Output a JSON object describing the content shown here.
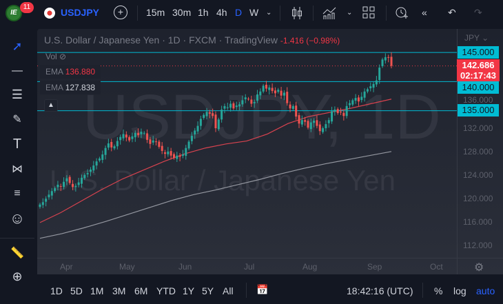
{
  "topbar": {
    "notifications": "11",
    "logo_text": "IE",
    "symbol": "USDJPY",
    "intervals": [
      "15m",
      "30m",
      "1h",
      "4h",
      "D",
      "W"
    ],
    "active_interval": "D"
  },
  "legend": {
    "title": "U.S. Dollar / Japanese Yen · 1D · FXCM · TradingView",
    "change": "-1.416 (−0.98%)",
    "vol_label": "Vol",
    "ema1_label": "EMA",
    "ema1_value": "136.880",
    "ema2_label": "EMA",
    "ema2_value": "127.838"
  },
  "watermark": {
    "line1": "USDJPY, 1D",
    "line2": "U.S. Dollar / Japanese Yen"
  },
  "price_axis": {
    "currency": "JPY",
    "labels": [
      "136.000",
      "132.000",
      "128.000",
      "124.000",
      "120.000",
      "116.000",
      "112.000"
    ],
    "levels": [
      "145.000",
      "140.000",
      "135.000"
    ],
    "current_price": "142.686",
    "countdown": "02:17:43"
  },
  "time_axis": [
    "Apr",
    "May",
    "Jun",
    "Jul",
    "Aug",
    "Sep",
    "Oct"
  ],
  "bottom": {
    "ranges": [
      "1D",
      "5D",
      "1M",
      "3M",
      "6M",
      "YTD",
      "1Y",
      "5Y",
      "All"
    ],
    "clock": "18:42:16 (UTC)",
    "percent": "%",
    "log": "log",
    "auto": "auto"
  },
  "colors": {
    "up": "#26a69a",
    "down": "#ef5350",
    "level": "#00bcd4",
    "price": "#f23645",
    "ema_fast": "#d9434f",
    "ema_slow": "#9598a1",
    "accent": "#2962ff"
  },
  "chart_data": {
    "type": "candlestick",
    "ylim": [
      110,
      149
    ],
    "horizontal_levels": [
      145,
      140,
      135
    ],
    "closes": [
      118.9,
      119.3,
      119.9,
      120.6,
      121.2,
      121.7,
      122.3,
      122.0,
      122.8,
      123.4,
      122.6,
      121.9,
      122.1,
      122.7,
      123.5,
      124.0,
      124.3,
      124.9,
      125.6,
      126.3,
      126.8,
      127.5,
      128.6,
      129.4,
      128.7,
      128.9,
      129.8,
      130.5,
      131.0,
      130.4,
      129.9,
      130.6,
      131.2,
      130.8,
      131.4,
      131.2,
      130.0,
      129.3,
      129.9,
      129.7,
      128.8,
      128.1,
      127.6,
      128.0,
      127.3,
      126.9,
      127.3,
      127.1,
      127.5,
      128.6,
      129.7,
      130.7,
      131.6,
      132.4,
      133.6,
      134.3,
      134.8,
      134.5,
      134.1,
      132.0,
      133.5,
      135.2,
      135.8,
      135.6,
      136.2,
      135.4,
      135.9,
      136.1,
      136.8,
      137.3,
      137.0,
      136.2,
      136.5,
      137.8,
      138.3,
      139.3,
      138.8,
      139.0,
      138.4,
      138.0,
      138.6,
      137.6,
      138.1,
      136.3,
      135.4,
      135.8,
      134.0,
      132.8,
      133.4,
      133.1,
      132.1,
      133.0,
      133.3,
      132.4,
      131.5,
      132.0,
      132.7,
      133.4,
      134.9,
      135.2,
      134.6,
      134.8,
      134.1,
      135.8,
      136.3,
      136.8,
      137.2,
      136.6,
      137.4,
      138.3,
      138.7,
      139.2,
      139.6,
      140.2,
      142.4,
      143.8,
      144.2,
      144.1,
      142.7
    ],
    "ema_fast": [
      115.8,
      117.5,
      119.5,
      121.5,
      123.3,
      124.8,
      126.3,
      127.6,
      128.6,
      129.3,
      129.8,
      131.0,
      132.8,
      134.0,
      134.7,
      135.4,
      136.2,
      137.0
    ],
    "ema_slow": [
      113.1,
      113.9,
      114.9,
      116.0,
      117.2,
      118.4,
      119.6,
      120.6,
      121.4,
      122.3,
      123.2,
      124.2,
      125.1,
      125.9,
      126.6,
      127.3,
      128.0
    ]
  }
}
